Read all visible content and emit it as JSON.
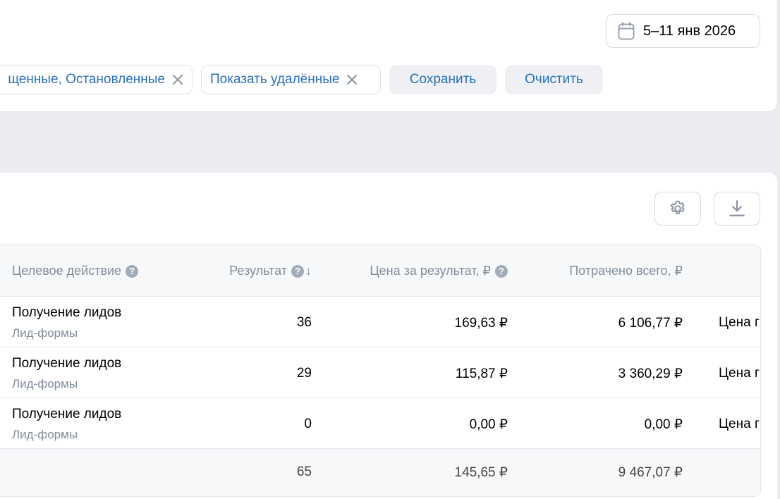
{
  "filters": {
    "date_range": "5–11 янв 2026",
    "chips": [
      {
        "label": "щенные, Остановленные"
      },
      {
        "label": "Показать удалённые"
      }
    ],
    "save_label": "Сохранить",
    "clear_label": "Очистить"
  },
  "table": {
    "columns": [
      {
        "label": "Целевое действие",
        "help": true
      },
      {
        "label": "Результат",
        "help": true,
        "sort": "desc"
      },
      {
        "label": "Цена за результат, ₽",
        "help": true
      },
      {
        "label": "Потрачено всего, ₽",
        "help": false
      }
    ],
    "rows": [
      {
        "action": "Получение лидов",
        "subtype": "Лид-формы",
        "result": "36",
        "price": "169,63 ₽",
        "spent": "6 106,77 ₽",
        "extra": "Цена г"
      },
      {
        "action": "Получение лидов",
        "subtype": "Лид-формы",
        "result": "29",
        "price": "115,87 ₽",
        "spent": "3 360,29 ₽",
        "extra": "Цена г"
      },
      {
        "action": "Получение лидов",
        "subtype": "Лид-формы",
        "result": "0",
        "price": "0,00 ₽",
        "spent": "0,00 ₽",
        "extra": "Цена г"
      }
    ],
    "totals": {
      "result": "65",
      "price": "145,65 ₽",
      "spent": "9 467,07 ₽"
    }
  },
  "icons": {
    "calendar": "calendar-icon",
    "close": "close-icon",
    "settings": "gear-icon",
    "download": "download-icon"
  },
  "colors": {
    "accent": "#2a6fb8",
    "muted": "#818c99",
    "background": "#ebecef"
  }
}
